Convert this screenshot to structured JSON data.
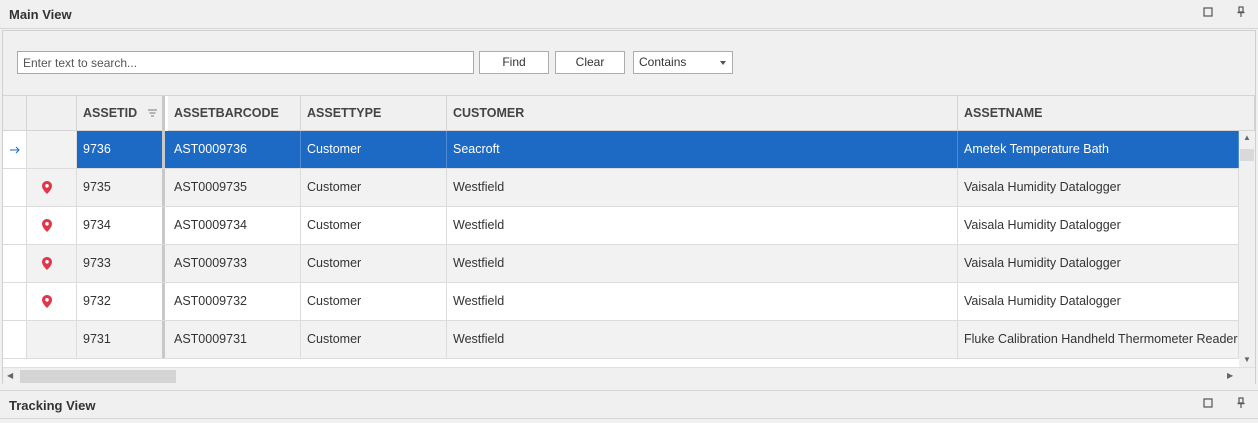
{
  "main_view": {
    "title": "Main View",
    "maximize_icon": "maximize-icon",
    "pin_icon": "pin-icon"
  },
  "search": {
    "placeholder": "Enter text to search...",
    "find_label": "Find",
    "clear_label": "Clear",
    "mode": "Contains"
  },
  "grid": {
    "columns": [
      "ASSETID",
      "ASSETBARCODE",
      "ASSETTYPE",
      "CUSTOMER",
      "ASSETNAME"
    ],
    "rows": [
      {
        "id": "9736",
        "barcode": "AST0009736",
        "type": "Customer",
        "customer": "Seacroft",
        "name": "Ametek Temperature Bath",
        "selected": true,
        "marker": false
      },
      {
        "id": "9735",
        "barcode": "AST0009735",
        "type": "Customer",
        "customer": "Westfield",
        "name": "Vaisala Humidity Datalogger",
        "marker": true
      },
      {
        "id": "9734",
        "barcode": "AST0009734",
        "type": "Customer",
        "customer": "Westfield",
        "name": "Vaisala Humidity Datalogger",
        "marker": true
      },
      {
        "id": "9733",
        "barcode": "AST0009733",
        "type": "Customer",
        "customer": "Westfield",
        "name": "Vaisala Humidity Datalogger",
        "marker": true
      },
      {
        "id": "9732",
        "barcode": "AST0009732",
        "type": "Customer",
        "customer": "Westfield",
        "name": "Vaisala Humidity Datalogger",
        "marker": true
      },
      {
        "id": "9731",
        "barcode": "AST0009731",
        "type": "Customer",
        "customer": "Westfield",
        "name": "Fluke Calibration Handheld Thermometer Reader",
        "marker": false
      }
    ]
  },
  "tracking_view": {
    "title": "Tracking View"
  },
  "colors": {
    "selection": "#1c6ac4",
    "marker": "#e0384b"
  }
}
